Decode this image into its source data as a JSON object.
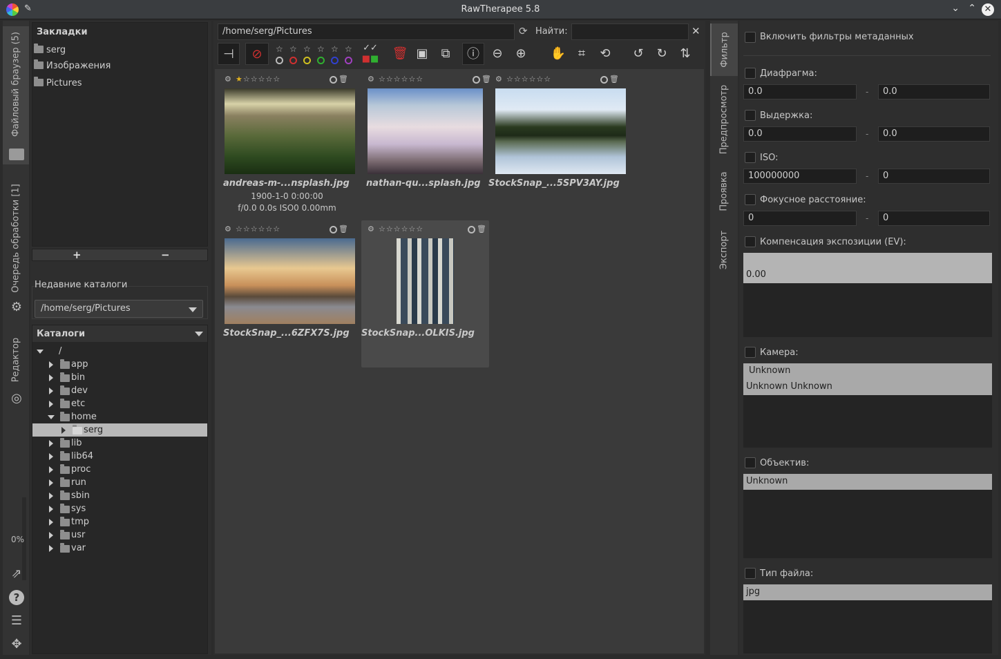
{
  "window": {
    "title": "RawTherapee 5.8"
  },
  "left_tabs": {
    "file_browser": "Файловый браузер (5)",
    "queue": "Очередь обработки [1]",
    "editor": "Редактор",
    "progress": "0%"
  },
  "bookmarks": {
    "title": "Закладки",
    "items": [
      "serg",
      "Изображения",
      "Pictures"
    ],
    "add": "+",
    "remove": "−"
  },
  "recent": {
    "title": "Недавние каталоги",
    "value": "/home/serg/Pictures"
  },
  "catalogs": {
    "title": "Каталоги",
    "root": "/",
    "tree": [
      "app",
      "bin",
      "dev",
      "etc",
      "home",
      "serg",
      "lib",
      "lib64",
      "proc",
      "run",
      "sbin",
      "sys",
      "tmp",
      "usr",
      "var"
    ]
  },
  "browser": {
    "path": "/home/serg/Pictures",
    "find_label": "Найти:",
    "find_value": ""
  },
  "thumbnails": [
    {
      "name": "andreas-m-...nsplash.jpg",
      "date": "1900-1-0 0:00:00",
      "exif": "f/0.0 0.0s ISO0 0.00mm",
      "rating": 1
    },
    {
      "name": "nathan-qu...splash.jpg",
      "rating": 0
    },
    {
      "name": "StockSnap_...5SPV3AY.jpg",
      "rating": 0
    },
    {
      "name": "StockSnap_...6ZFX7S.jpg",
      "rating": 0
    },
    {
      "name": "StockSnap...OLKIS.jpg",
      "rating": 0
    }
  ],
  "right_tabs": [
    "Фильтр",
    "Предпросмотр",
    "Проявка",
    "Экспорт"
  ],
  "filter": {
    "enable_meta": "Включить фильтры метаданных",
    "aperture": {
      "label": "Диафрагма:",
      "from": "0.0",
      "to": "0.0"
    },
    "shutter": {
      "label": "Выдержка:",
      "from": "0.0",
      "to": "0.0"
    },
    "iso": {
      "label": "ISO:",
      "from": "100000000",
      "to": "0"
    },
    "focal": {
      "label": "Фокусное расстояние:",
      "from": "0",
      "to": "0"
    },
    "ev": {
      "label": "Компенсация экспозиции (EV):",
      "items": [
        "0.00"
      ]
    },
    "camera": {
      "label": "Камера:",
      "items": [
        "Unknown",
        "Unknown Unknown"
      ]
    },
    "lens": {
      "label": "Объектив:",
      "items": [
        "Unknown"
      ]
    },
    "filetype": {
      "label": "Тип файла:",
      "items": [
        "jpg"
      ]
    },
    "range_sep": "-"
  },
  "colors": {
    "accent_red": "#d03030",
    "selection": "#b8b8b8"
  }
}
